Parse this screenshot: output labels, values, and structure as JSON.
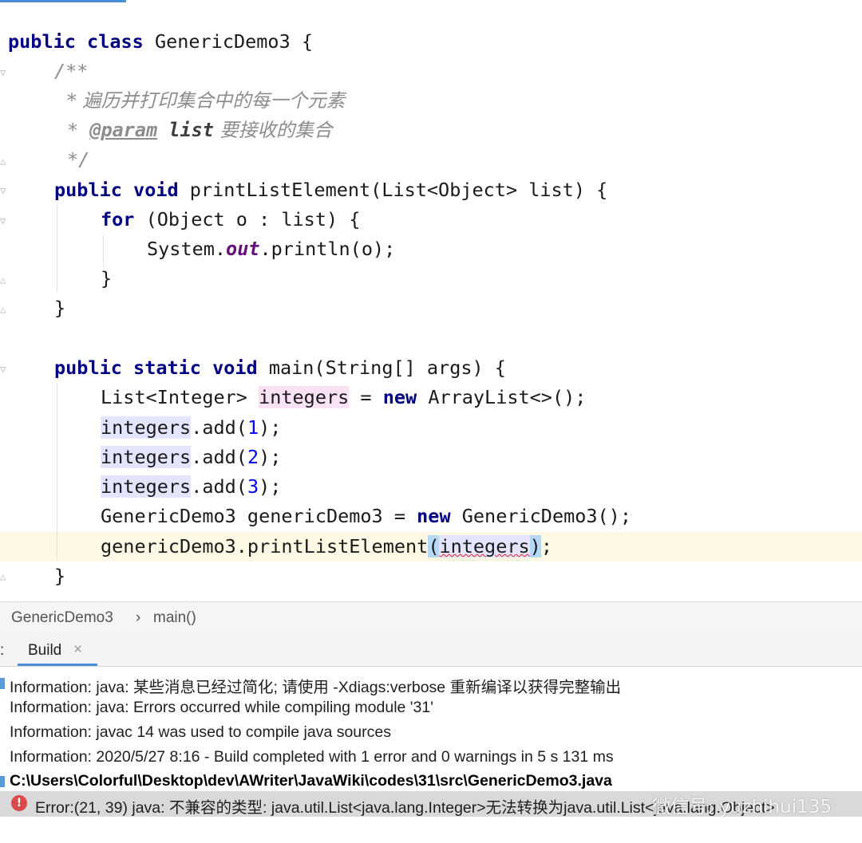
{
  "code": {
    "l1": {
      "kw1": "public",
      "kw2": "class",
      "name": " GenericDemo3 {"
    },
    "l2": "/**",
    "l3": "* 遍历并打印集合中的每一个元素",
    "l4": {
      "star": "* ",
      "tag": "@param",
      "val": "list",
      "desc": " 要接收的集合"
    },
    "l5": "*/",
    "l6": {
      "kw1": "public",
      "kw2": "void",
      "rest": " printListElement(List<Object> list) {"
    },
    "l7": {
      "kw": "for",
      "rest": " (Object o : list) {"
    },
    "l8": {
      "pre": "System.",
      "field": "out",
      "post": ".println(o);"
    },
    "l9": "}",
    "l10": "}",
    "l12": {
      "kw1": "public",
      "kw2": "static",
      "kw3": "void",
      "rest": " main(String[] args) {"
    },
    "l13": {
      "pre": "List<Integer> ",
      "var": "integers",
      "mid": " = ",
      "kw": "new",
      "post": " ArrayList<>();"
    },
    "l14": {
      "var": "integers",
      "post": ".add(",
      "num": "1",
      "end": ");"
    },
    "l15": {
      "var": "integers",
      "post": ".add(",
      "num": "2",
      "end": ");"
    },
    "l16": {
      "var": "integers",
      "post": ".add(",
      "num": "3",
      "end": ");"
    },
    "l17": {
      "pre": "GenericDemo3 genericDemo3 = ",
      "kw": "new",
      "post": " GenericDemo3();"
    },
    "l18": {
      "pre": "genericDemo3.printListElement",
      "open": "(",
      "arg": "integers",
      "close": ")",
      "end": ";"
    },
    "l19": "}"
  },
  "breadcrumb": {
    "class_name": "GenericDemo3",
    "separator": "›",
    "method": "main()"
  },
  "build_panel": {
    "colon": ":",
    "tab_label": "Build",
    "tab_close": "×",
    "messages": [
      "Information: java: 某些消息已经过简化; 请使用 -Xdiags:verbose 重新编译以获得完整输出",
      "Information: java: Errors occurred while compiling module '31'",
      "Information: javac 14 was used to compile java sources",
      "Information: 2020/5/27 8:16 - Build completed with 1 error and 0 warnings in 5 s 131 ms"
    ],
    "file_path": "C:\\Users\\Colorful\\Desktop\\dev\\AWriter\\JavaWiki\\codes\\31\\src\\GenericDemo3.java",
    "error_icon": "!",
    "error_text": "Error:(21, 39)  java: 不兼容的类型: java.util.List<java.lang.Integer>无法转换为java.util.List<java.lang.Object>"
  },
  "watermark": "微信号: yuzhihui135",
  "colors": {
    "keyword": "#000080",
    "comment": "#8c8c8c",
    "number": "#0000ff",
    "error": "#d94a4a",
    "accent": "#4a8fd8"
  }
}
